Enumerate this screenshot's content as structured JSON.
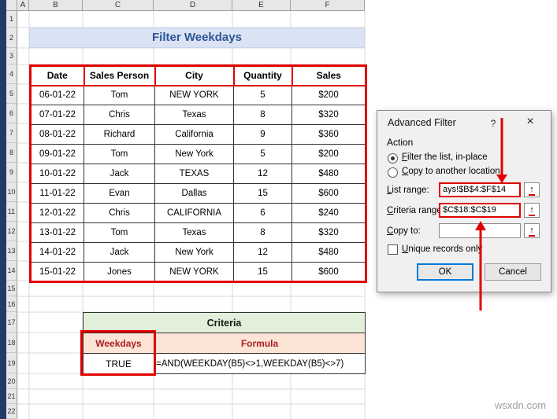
{
  "sheet": {
    "cols": [
      "A",
      "B",
      "C",
      "D",
      "E",
      "F"
    ],
    "rows": [
      "1",
      "2",
      "3",
      "4",
      "5",
      "6",
      "7",
      "8",
      "9",
      "10",
      "11",
      "12",
      "13",
      "14",
      "15",
      "16",
      "17",
      "18",
      "19",
      "20",
      "21",
      "22"
    ],
    "title_banner": "Filter Weekdays",
    "table": {
      "headers": [
        "Date",
        "Sales Person",
        "City",
        "Quantity",
        "Sales"
      ],
      "rows": [
        [
          "06-01-22",
          "Tom",
          "NEW YORK",
          "5",
          "$200"
        ],
        [
          "07-01-22",
          "Chris",
          "Texas",
          "8",
          "$320"
        ],
        [
          "08-01-22",
          "Richard",
          "California",
          "9",
          "$360"
        ],
        [
          "09-01-22",
          "Tom",
          "New York",
          "5",
          "$200"
        ],
        [
          "10-01-22",
          "Jack",
          "TEXAS",
          "12",
          "$480"
        ],
        [
          "11-01-22",
          "Evan",
          "Dallas",
          "15",
          "$600"
        ],
        [
          "12-01-22",
          "Chris",
          "CALIFORNIA",
          "6",
          "$240"
        ],
        [
          "13-01-22",
          "Tom",
          "Texas",
          "8",
          "$320"
        ],
        [
          "14-01-22",
          "Jack",
          "New York",
          "12",
          "$480"
        ],
        [
          "15-01-22",
          "Jones",
          "NEW YORK",
          "15",
          "$600"
        ]
      ]
    },
    "criteria_table": {
      "title": "Criteria",
      "headers": [
        "Weekdays",
        "Formula"
      ],
      "values": [
        "TRUE",
        "=AND(WEEKDAY(B5)<>1,WEEKDAY(B5)<>7)"
      ]
    }
  },
  "dialog": {
    "title": "Advanced Filter",
    "help": "?",
    "close": "×",
    "action_label": "Action",
    "radios": [
      {
        "label": "Filter the list, in-place",
        "selected": true
      },
      {
        "label": "Copy to another location",
        "selected": false
      }
    ],
    "fields": [
      {
        "label": "List range:",
        "value": "ays!$B$4:$F$14"
      },
      {
        "label": "Criteria range:",
        "value": "$C$18:$C$19"
      },
      {
        "label": "Copy to:",
        "value": ""
      }
    ],
    "unique_checkbox_label": "Unique records only",
    "range_picker_icon": "↑",
    "ok": "OK",
    "cancel": "Cancel"
  },
  "watermark": "wsxdn.com",
  "colors": {
    "annotation_red": "#e00000",
    "banner_bg": "#dae3f3",
    "banner_text": "#2f5597",
    "criteria_green_bg": "#e2efda",
    "criteria_pink_bg": "#fce4d6",
    "criteria_pink_text": "#aa2222",
    "sidebar_navy": "#1e3c64",
    "ok_focus_border": "#0078d7"
  }
}
